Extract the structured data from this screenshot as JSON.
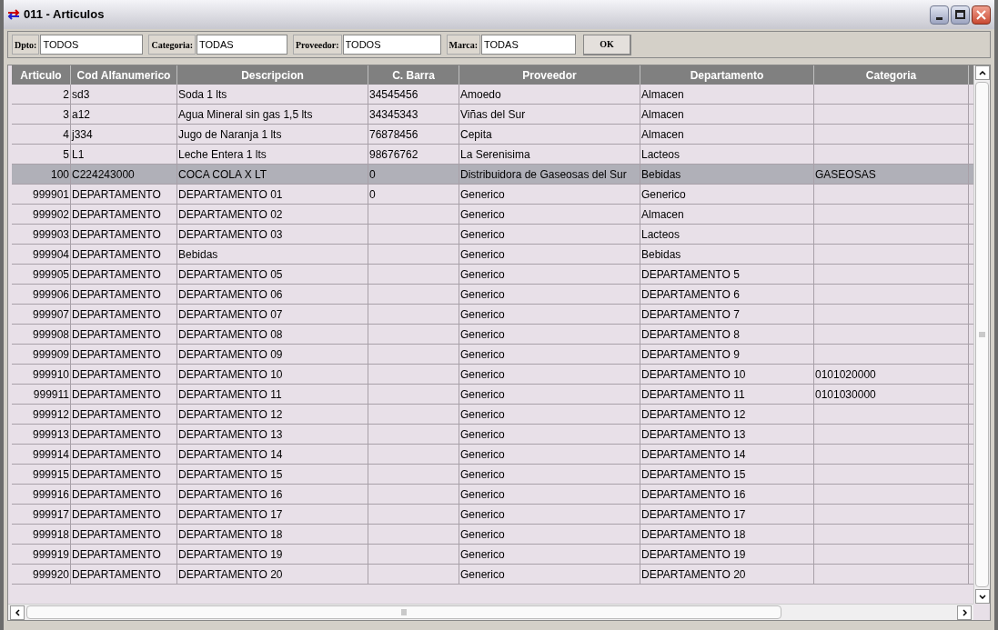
{
  "window": {
    "title": "011 - Articulos"
  },
  "filters": [
    {
      "label": "Dpto:",
      "value": "TODOS"
    },
    {
      "label": "Categoria:",
      "value": "TODAS"
    },
    {
      "label": "Proveedor:",
      "value": "TODOS"
    },
    {
      "label": "Marca:",
      "value": "TODAS"
    }
  ],
  "ok_button": "OK",
  "table": {
    "columns": [
      "Articulo",
      "Cod Alfanumerico",
      "Descripcion",
      "C. Barra",
      "Proveedor",
      "Departamento",
      "Categoria"
    ],
    "rows": [
      {
        "selected": false,
        "cells": [
          "2",
          "sd3",
          "Soda 1 lts",
          "34545456",
          "Amoedo",
          "Almacen",
          ""
        ]
      },
      {
        "selected": false,
        "cells": [
          "3",
          "a12",
          "Agua Mineral sin gas 1,5 lts",
          "34345343",
          "Viñas del Sur",
          "Almacen",
          ""
        ]
      },
      {
        "selected": false,
        "cells": [
          "4",
          "j334",
          "Jugo de Naranja 1 lts",
          "76878456",
          "Cepita",
          "Almacen",
          ""
        ]
      },
      {
        "selected": false,
        "cells": [
          "5",
          "L1",
          "Leche Entera 1 lts",
          "98676762",
          "La Serenisima",
          "Lacteos",
          ""
        ]
      },
      {
        "selected": true,
        "cells": [
          "100",
          "C224243000",
          "COCA COLA X LT",
          "0",
          "Distribuidora de Gaseosas del Sur",
          "Bebidas",
          "GASEOSAS"
        ]
      },
      {
        "selected": false,
        "cells": [
          "999901",
          "DEPARTAMENTO",
          "DEPARTAMENTO 01",
          "0",
          "Generico",
          "Generico",
          ""
        ]
      },
      {
        "selected": false,
        "cells": [
          "999902",
          "DEPARTAMENTO",
          "DEPARTAMENTO 02",
          "",
          "Generico",
          "Almacen",
          ""
        ]
      },
      {
        "selected": false,
        "cells": [
          "999903",
          "DEPARTAMENTO",
          "DEPARTAMENTO 03",
          "",
          "Generico",
          "Lacteos",
          ""
        ]
      },
      {
        "selected": false,
        "cells": [
          "999904",
          "DEPARTAMENTO",
          "Bebidas",
          "",
          "Generico",
          "Bebidas",
          ""
        ]
      },
      {
        "selected": false,
        "cells": [
          "999905",
          "DEPARTAMENTO",
          "DEPARTAMENTO 05",
          "",
          "Generico",
          "DEPARTAMENTO 5",
          ""
        ]
      },
      {
        "selected": false,
        "cells": [
          "999906",
          "DEPARTAMENTO",
          "DEPARTAMENTO 06",
          "",
          "Generico",
          "DEPARTAMENTO 6",
          ""
        ]
      },
      {
        "selected": false,
        "cells": [
          "999907",
          "DEPARTAMENTO",
          "DEPARTAMENTO 07",
          "",
          "Generico",
          "DEPARTAMENTO 7",
          ""
        ]
      },
      {
        "selected": false,
        "cells": [
          "999908",
          "DEPARTAMENTO",
          "DEPARTAMENTO 08",
          "",
          "Generico",
          "DEPARTAMENTO 8",
          ""
        ]
      },
      {
        "selected": false,
        "cells": [
          "999909",
          "DEPARTAMENTO",
          "DEPARTAMENTO 09",
          "",
          "Generico",
          "DEPARTAMENTO 9",
          ""
        ]
      },
      {
        "selected": false,
        "cells": [
          "999910",
          "DEPARTAMENTO",
          "DEPARTAMENTO 10",
          "",
          "Generico",
          "DEPARTAMENTO 10",
          "0101020000"
        ]
      },
      {
        "selected": false,
        "cells": [
          "999911",
          "DEPARTAMENTO",
          "DEPARTAMENTO 11",
          "",
          "Generico",
          "DEPARTAMENTO 11",
          "0101030000"
        ]
      },
      {
        "selected": false,
        "cells": [
          "999912",
          "DEPARTAMENTO",
          "DEPARTAMENTO 12",
          "",
          "Generico",
          "DEPARTAMENTO 12",
          ""
        ]
      },
      {
        "selected": false,
        "cells": [
          "999913",
          "DEPARTAMENTO",
          "DEPARTAMENTO 13",
          "",
          "Generico",
          "DEPARTAMENTO 13",
          ""
        ]
      },
      {
        "selected": false,
        "cells": [
          "999914",
          "DEPARTAMENTO",
          "DEPARTAMENTO 14",
          "",
          "Generico",
          "DEPARTAMENTO 14",
          ""
        ]
      },
      {
        "selected": false,
        "cells": [
          "999915",
          "DEPARTAMENTO",
          "DEPARTAMENTO 15",
          "",
          "Generico",
          "DEPARTAMENTO 15",
          ""
        ]
      },
      {
        "selected": false,
        "cells": [
          "999916",
          "DEPARTAMENTO",
          "DEPARTAMENTO 16",
          "",
          "Generico",
          "DEPARTAMENTO 16",
          ""
        ]
      },
      {
        "selected": false,
        "cells": [
          "999917",
          "DEPARTAMENTO",
          "DEPARTAMENTO 17",
          "",
          "Generico",
          "DEPARTAMENTO 17",
          ""
        ]
      },
      {
        "selected": false,
        "cells": [
          "999918",
          "DEPARTAMENTO",
          "DEPARTAMENTO 18",
          "",
          "Generico",
          "DEPARTAMENTO 18",
          ""
        ]
      },
      {
        "selected": false,
        "cells": [
          "999919",
          "DEPARTAMENTO",
          "DEPARTAMENTO 19",
          "",
          "Generico",
          "DEPARTAMENTO 19",
          ""
        ]
      },
      {
        "selected": false,
        "cells": [
          "999920",
          "DEPARTAMENTO",
          "DEPARTAMENTO 20",
          "",
          "Generico",
          "DEPARTAMENTO 20",
          ""
        ]
      }
    ]
  }
}
